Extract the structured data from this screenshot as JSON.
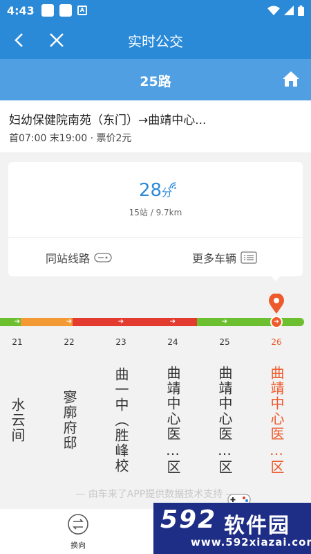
{
  "status_bar": {
    "time": "4:43",
    "badge": "A"
  },
  "header": {
    "title": "实时公交"
  },
  "route": {
    "name": "25路",
    "direction": "妇幼保健院南苑（东门）→曲靖中心...",
    "schedule": "首07:00 末19:00 · 票价2元"
  },
  "eta": {
    "minutes": "28",
    "unit": "分",
    "detail": "15站 / 9.7km"
  },
  "actions": {
    "same_station": "同站线路",
    "more_buses": "更多车辆"
  },
  "stops": [
    {
      "num": "21",
      "name": "水云间"
    },
    {
      "num": "22",
      "name": "寥廓府邸"
    },
    {
      "num": "23",
      "name": "曲一中︵胜峰校"
    },
    {
      "num": "24",
      "name": "曲靖中心医…区"
    },
    {
      "num": "25",
      "name": "曲靖中心医…区"
    },
    {
      "num": "26",
      "name": "曲靖中心医…区"
    }
  ],
  "footer": {
    "credit": "— 由车来了APP提供数据技术支持 —",
    "reverse_label": "换向"
  },
  "watermark": {
    "num": "592",
    "text": "软件园",
    "url": "www.592xiazai.com"
  },
  "colors": {
    "primary": "#2b8ad8",
    "route_bar": "#4f9fe2",
    "current": "#ee5a2c",
    "line_green": "#6cbf2f",
    "line_orange": "#f39a34",
    "line_red": "#e43b30"
  }
}
